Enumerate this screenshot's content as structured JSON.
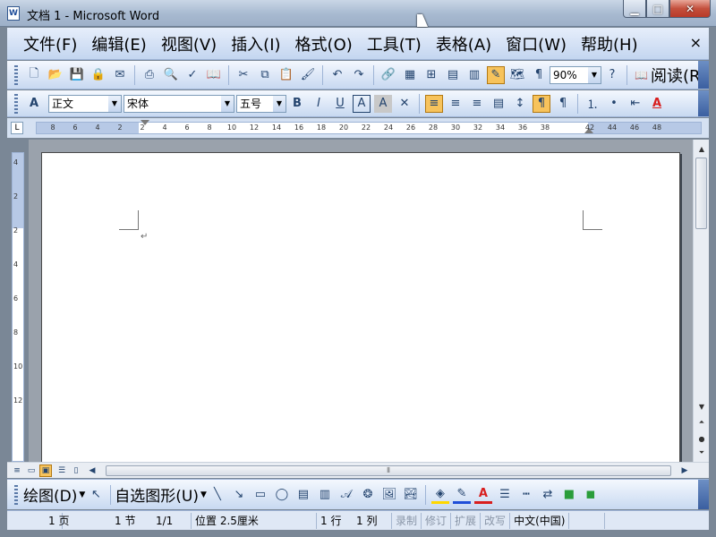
{
  "window": {
    "title": "文档 1 - Microsoft Word",
    "icon_label": "W"
  },
  "menu": {
    "items": [
      "文件(F)",
      "编辑(E)",
      "视图(V)",
      "插入(I)",
      "格式(O)",
      "工具(T)",
      "表格(A)",
      "窗口(W)",
      "帮助(H)"
    ],
    "close_glyph": "×"
  },
  "toolbar": {
    "zoom_value": "90%",
    "read_label": "阅读(R)"
  },
  "format_toolbar": {
    "style_value": "正文",
    "font_value": "宋体",
    "size_value": "五号"
  },
  "ruler": {
    "h_ticks": [
      "8",
      "6",
      "4",
      "2",
      "2",
      "4",
      "6",
      "8",
      "10",
      "12",
      "14",
      "16",
      "18",
      "20",
      "22",
      "24",
      "26",
      "28",
      "30",
      "32",
      "34",
      "36",
      "38",
      "42",
      "44",
      "46",
      "48"
    ],
    "v_ticks": [
      "4",
      "2",
      "2",
      "4",
      "6",
      "8",
      "10",
      "12"
    ]
  },
  "document": {
    "paragraph_mark": "↵"
  },
  "drawbar": {
    "draw_label": "绘图(D)",
    "autoshape_label": "自选图形(U)"
  },
  "status": {
    "page": "1 页",
    "section": "1 节",
    "page_of": "1/1",
    "position": "位置 2.5厘米",
    "line": "1 行",
    "column": "1 列",
    "rec": "录制",
    "trk": "修订",
    "ext": "扩展",
    "ovr": "改写",
    "language": "中文(中国)"
  },
  "colors": {
    "accent": "#c4d6f0",
    "selected": "#f7c35c",
    "font_color": "#d81e1e"
  }
}
